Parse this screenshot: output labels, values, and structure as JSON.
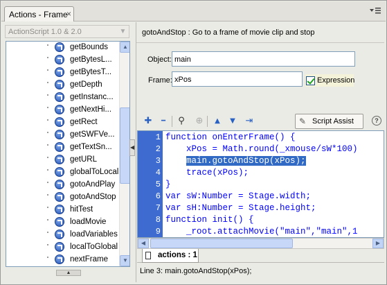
{
  "panel": {
    "title": "Actions - Frame",
    "close_glyph": "×",
    "menu_icon": "panel-menu-icon"
  },
  "left": {
    "language": "ActionScript 1.0 & 2.0",
    "items": [
      "getBounds",
      "getBytesL...",
      "getBytesT...",
      "getDepth",
      "getInstanc...",
      "getNextHi...",
      "getRect",
      "getSWFVe...",
      "getTextSn...",
      "getURL",
      "globalToLocal",
      "gotoAndPlay",
      "gotoAndStop",
      "hitTest",
      "loadMovie",
      "loadVariables",
      "localToGlobal",
      "nextFrame"
    ],
    "scroll_up": "▲",
    "scroll_down": "▼",
    "collapse_glyph": "▲"
  },
  "splitter_glyph": "◀",
  "description": "gotoAndStop : Go to a frame of movie clip and stop",
  "params": {
    "object_label": "Object:",
    "object_value": "main",
    "frame_label": "Frame:",
    "frame_value": "xPos",
    "expression_label": "Expression",
    "expression_checked": true
  },
  "toolbar": {
    "add_icon": "✚",
    "remove_icon": "━",
    "find_icon": "⚲",
    "target_icon": "⊕",
    "up_icon": "▲",
    "down_icon": "▼",
    "insert_icon": "⇥",
    "script_assist_label": "Script Assist",
    "script_assist_icon": "✎",
    "help_label": "?"
  },
  "code": {
    "lines": [
      {
        "n": "1",
        "text": "function onEnterFrame() {"
      },
      {
        "n": "2",
        "text": "    xPos = Math.round(_xmouse/sW*100)"
      },
      {
        "n": "3",
        "text": "    main.gotoAndStop(xPos);"
      },
      {
        "n": "4",
        "text": "    trace(xPos);"
      },
      {
        "n": "5",
        "text": "}"
      },
      {
        "n": "6",
        "text": "var sW:Number = Stage.width;"
      },
      {
        "n": "7",
        "text": "var sH:Number = Stage.height;"
      },
      {
        "n": "8",
        "text": "function init() {"
      },
      {
        "n": "9",
        "text": "    _root.attachMovie(\"main\",\"main\",1"
      }
    ],
    "selected_line": 3
  },
  "hscroll": {
    "left": "◀",
    "right": "▶"
  },
  "script_tab": "actions : 1",
  "status": "Line 3: main.gotoAndStop(xPos);"
}
